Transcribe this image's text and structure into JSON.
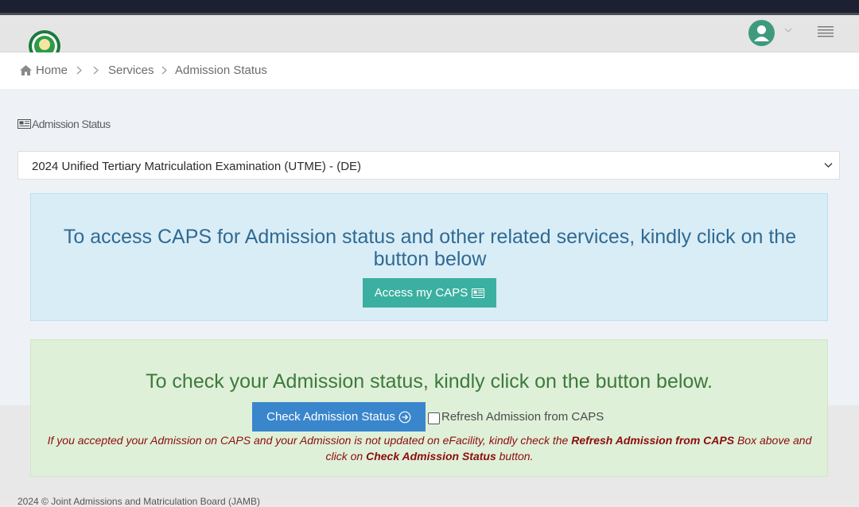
{
  "breadcrumb": {
    "home": "Home",
    "services": "Services",
    "current": "Admission Status"
  },
  "section": {
    "title": "Admission Status"
  },
  "exam_select": {
    "selected": "2024 Unified Tertiary Matriculation Examination (UTME) - (DE)"
  },
  "caps_box": {
    "message": "To access CAPS for Admission status and other related services, kindly click on the button below",
    "button_label": "Access my CAPS"
  },
  "status_box": {
    "message": "To check your Admission status, kindly click on the button below.",
    "button_label": "Check Admission Status",
    "refresh_label": "Refresh Admission from CAPS",
    "note_part1": "If you accepted your Admission on CAPS and your Admission is not updated on eFacility, kindly check the ",
    "note_bold1": "Refresh Admission from CAPS",
    "note_part2": " Box above and click on ",
    "note_bold2": "Check Admission Status",
    "note_part3": " button."
  },
  "footer": {
    "text": "2024 © Joint Admissions and Matriculation Board (JAMB)"
  },
  "colors": {
    "caps_button": "#3bb0a0",
    "check_button": "#3a86cc",
    "info_bg": "#d9edf7",
    "success_bg": "#dff0d8",
    "note_text": "#8b0d0d"
  }
}
